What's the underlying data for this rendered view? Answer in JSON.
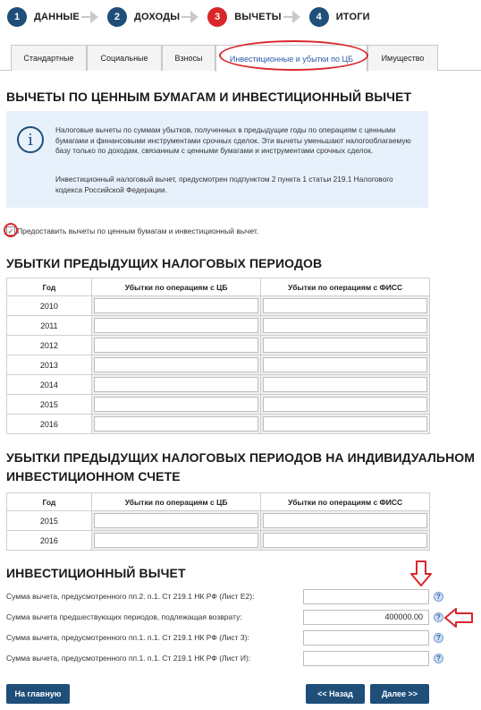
{
  "steps": [
    {
      "num": "1",
      "label": "ДАННЫЕ"
    },
    {
      "num": "2",
      "label": "ДОХОДЫ"
    },
    {
      "num": "3",
      "label": "ВЫЧЕТЫ"
    },
    {
      "num": "4",
      "label": "ИТОГИ"
    }
  ],
  "tabs": [
    "Стандартные",
    "Социальные",
    "Взносы",
    "Инвестиционные и убытки по ЦБ",
    "Имущество"
  ],
  "section1": {
    "title": "ВЫЧЕТЫ ПО ЦЕННЫМ БУМАГАМ И ИНВЕСТИЦИОННЫЙ ВЫЧЕТ",
    "info_p1": "Налоговые вычеты по суммам убытков, полученных в предыдущие годы по операциям с ценными бумагами и финансовыми инструментами срочных сделок. Эти вычеты уменьшают налогооблагаемую базу только по доходам, связанным с ценными бумагами и инструментами срочных сделок.",
    "info_p2": "Инвестиционный налоговый вычет, предусмотрен подпунктом 2 пункта 1 статьи 219.1 Налогового кодекса Российской Федерации.",
    "checkbox_mark": "✓",
    "checkbox_label": "Предоставить вычеты по ценным бумагам и инвестиционный вычет."
  },
  "losses": {
    "title": "УБЫТКИ ПРЕДЫДУЩИХ НАЛОГОВЫХ ПЕРИОДОВ",
    "headers": [
      "Год",
      "Убытки по операциям с ЦБ",
      "Убытки по операциям с ФИСС"
    ],
    "years": [
      "2010",
      "2011",
      "2012",
      "2013",
      "2014",
      "2015",
      "2016"
    ]
  },
  "iis": {
    "title_line1": "УБЫТКИ ПРЕДЫДУЩИХ НАЛОГОВЫХ ПЕРИОДОВ НА ИНДИВИДУАЛЬНОМ",
    "title_line2": "ИНВЕСТИЦИОННОМ СЧЕТЕ",
    "headers": [
      "Год",
      "Убытки по операциям с ЦБ",
      "Убытки по операциям с ФИСС"
    ],
    "years": [
      "2015",
      "2016"
    ]
  },
  "invest": {
    "title": "ИНВЕСТИЦИОННЫЙ ВЫЧЕТ",
    "rows": [
      {
        "label": "Сумма вычета, предусмотренного пп.2. п.1. Ст 219.1 НК РФ (Лист Е2):",
        "value": ""
      },
      {
        "label": "Сумма вычета предшествующих периодов, подлежащая возврату:",
        "value": "400000.00"
      },
      {
        "label": "Сумма вычета, предусмотренного пп.1. п.1. Ст 219.1 НК РФ (Лист 3):",
        "value": ""
      },
      {
        "label": "Сумма вычета, предусмотренного пп.1. п.1. Ст 219.1 НК РФ (Лист И):",
        "value": ""
      }
    ],
    "help_glyph": "?"
  },
  "buttons": {
    "home": "На главную",
    "back": "<< Назад",
    "next": "Далее >>"
  },
  "colors": {
    "accent": "#1f4e79",
    "active_step": "#d9262b",
    "annotation": "#d9262b",
    "info_bg": "#e7f1fb"
  }
}
